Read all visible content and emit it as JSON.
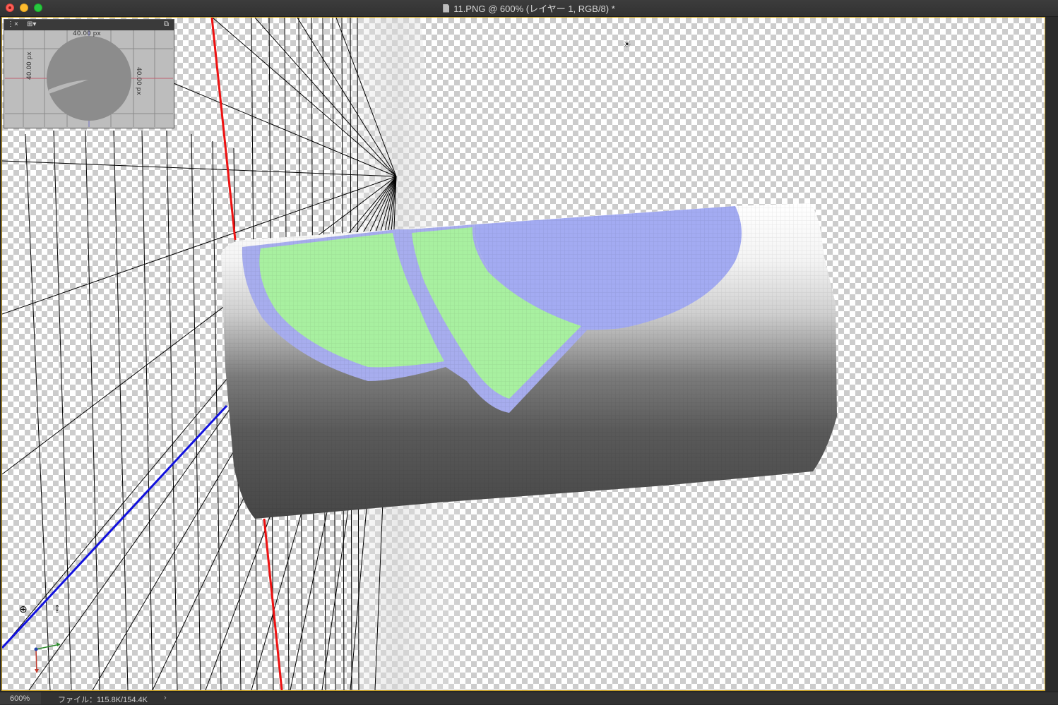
{
  "window": {
    "title": "11.PNG @ 600% (レイヤー 1, RGB/8) *"
  },
  "mini_panel": {
    "top_dimension": "40.00 px",
    "left_dimension": "40.00 px",
    "right_dimension": "40.00 px"
  },
  "status": {
    "zoom": "600%",
    "file_info": "ファイル：115.8K/154.4K",
    "arrow": "›"
  },
  "colors": {
    "canvas_border": "#c9a227",
    "axis_x": "#e11",
    "axis_y": "#11d",
    "paint_green": "#a8f0a0",
    "paint_blue": "#a3abf2"
  },
  "icons": {
    "sun": "light-source-icon",
    "widget": "3d-widget-icon",
    "cursor": "cursor-icon"
  }
}
